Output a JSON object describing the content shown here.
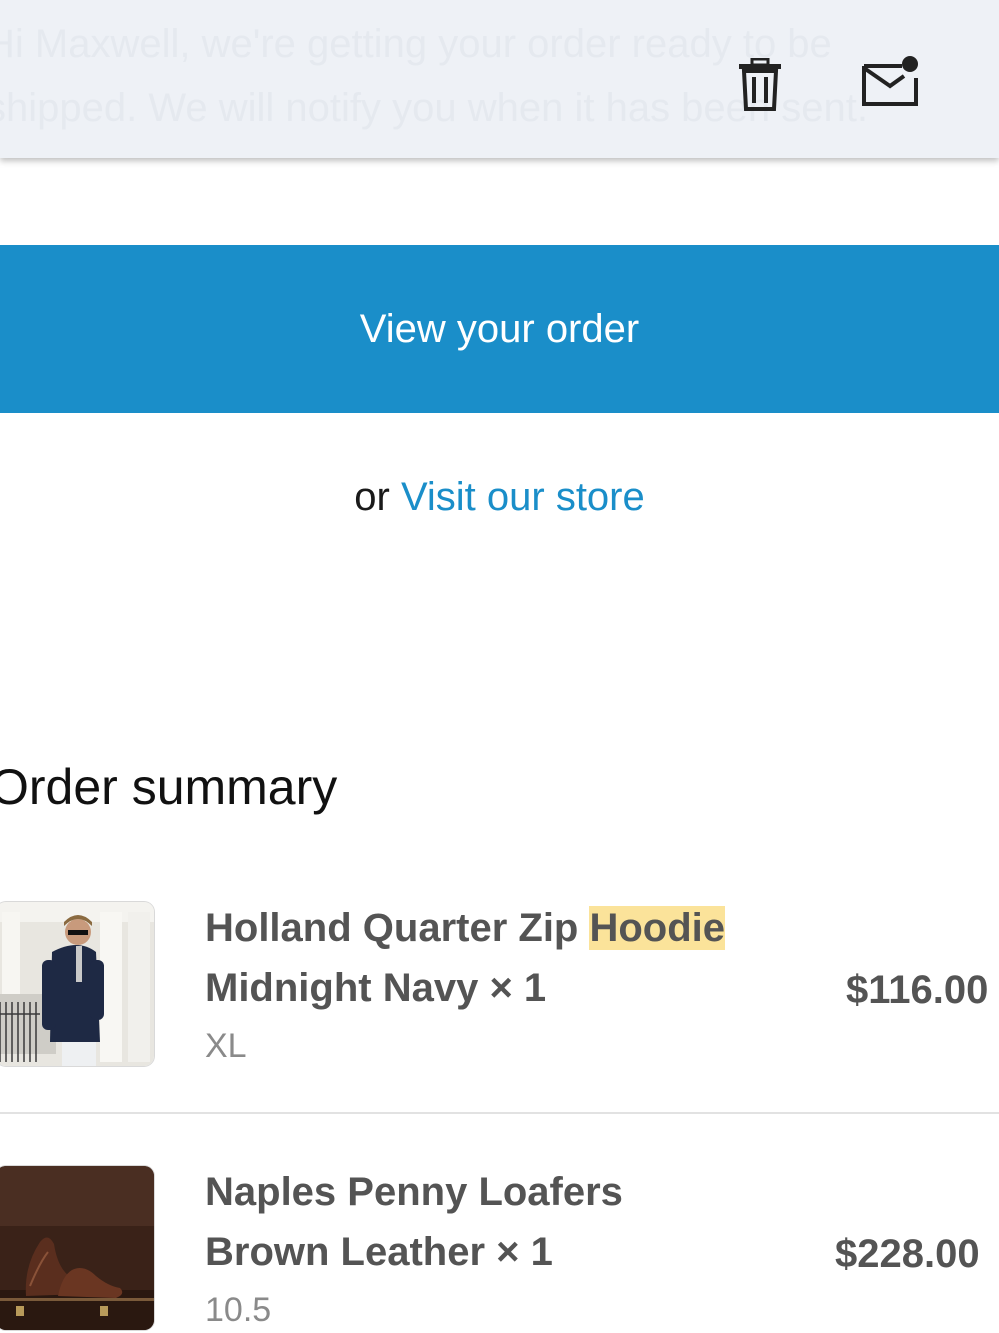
{
  "preview": {
    "text": "Hi Maxwell, we're getting your order ready to be shipped. We will notify you when it has been sent."
  },
  "toolbar": {
    "delete_icon": "trash-icon",
    "mark_unread_icon": "mail-unread-icon"
  },
  "cta": {
    "view_order_label": "View your order",
    "or_text": "or ",
    "visit_store_label": "Visit our store"
  },
  "order_summary": {
    "title": "Order summary",
    "items": [
      {
        "name_main": "Holland Quarter Zip ",
        "name_highlight": "Hoodie",
        "variant": "Midnight Navy × 1",
        "option": "XL",
        "price": "$116.00"
      },
      {
        "name_main": "Naples Penny Loafers",
        "name_highlight": "",
        "variant": "Brown Leather × 1",
        "option": "10.5",
        "price": "$228.00"
      }
    ]
  },
  "colors": {
    "accent": "#1a8ec9",
    "highlight": "#fbe39a",
    "top_bar": "#eef1f6"
  }
}
